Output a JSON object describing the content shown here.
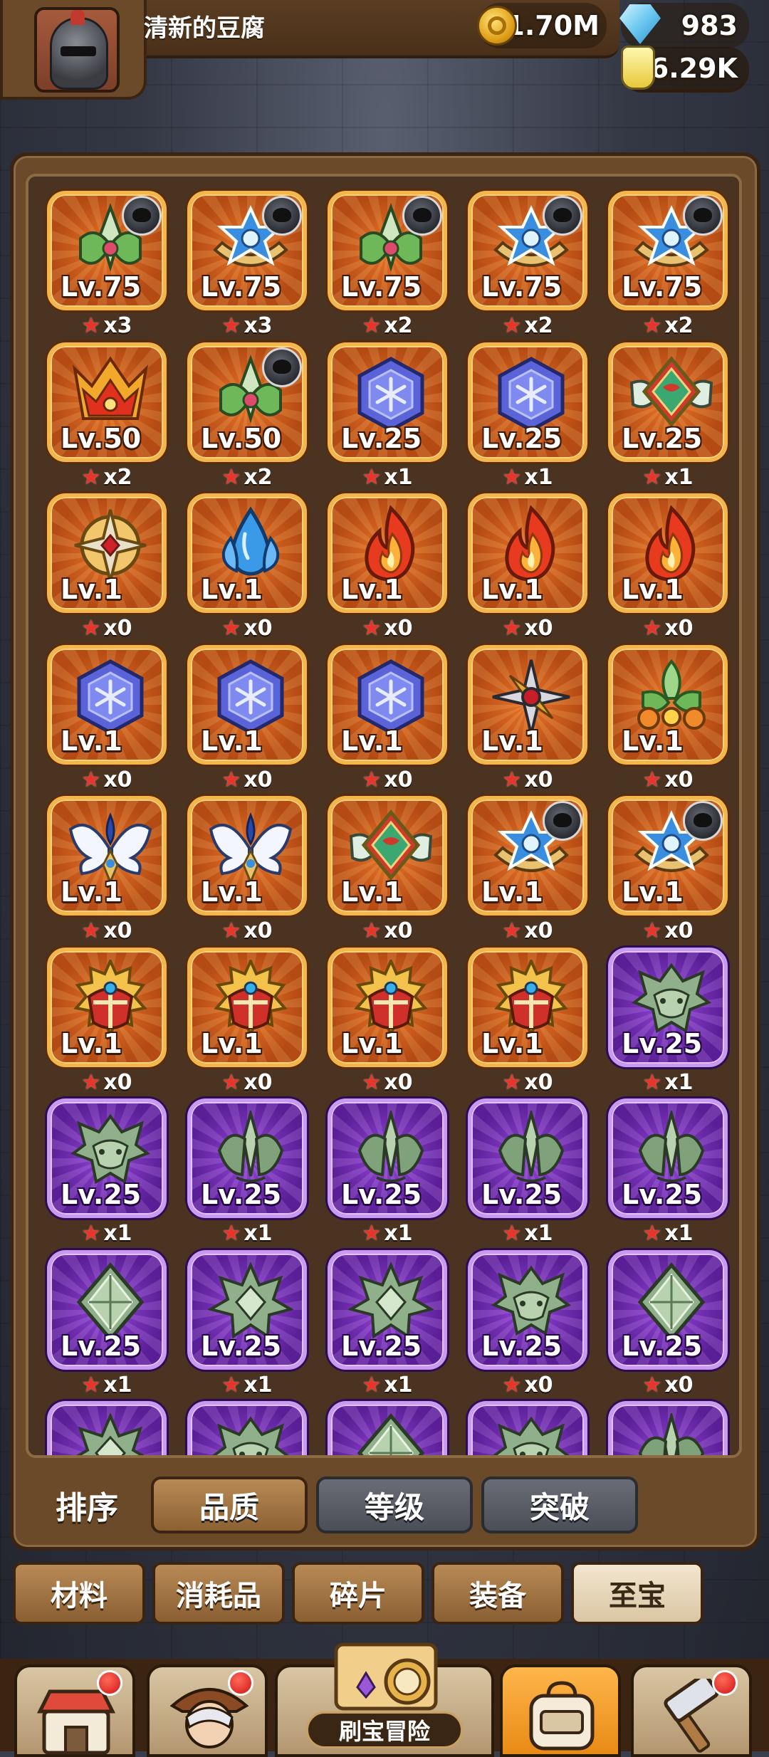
{
  "player": {
    "name": "清新的豆腐"
  },
  "currencies": {
    "gold": "1.70M",
    "diamonds": "983",
    "potion": "6.29K"
  },
  "colors": {
    "orange_rarity": "#d0621f",
    "purple_rarity": "#7a35bd",
    "star": "#e8342a"
  },
  "items": [
    {
      "level": "Lv.75",
      "stars": "x3",
      "rarity": "orange",
      "icon": "green-leaf-emblem",
      "hero": true
    },
    {
      "level": "Lv.75",
      "stars": "x3",
      "rarity": "orange",
      "icon": "blue-star-emblem",
      "hero": true
    },
    {
      "level": "Lv.75",
      "stars": "x2",
      "rarity": "orange",
      "icon": "green-leaf-emblem",
      "hero": true
    },
    {
      "level": "Lv.75",
      "stars": "x2",
      "rarity": "orange",
      "icon": "blue-star-emblem",
      "hero": true
    },
    {
      "level": "Lv.75",
      "stars": "x2",
      "rarity": "orange",
      "icon": "blue-star-emblem",
      "hero": true
    },
    {
      "level": "Lv.50",
      "stars": "x2",
      "rarity": "orange",
      "icon": "fire-crown-emblem",
      "hero": false
    },
    {
      "level": "Lv.50",
      "stars": "x2",
      "rarity": "orange",
      "icon": "green-leaf-emblem",
      "hero": true
    },
    {
      "level": "Lv.25",
      "stars": "x1",
      "rarity": "orange",
      "icon": "snowflake-gem",
      "hero": false
    },
    {
      "level": "Lv.25",
      "stars": "x1",
      "rarity": "orange",
      "icon": "snowflake-gem",
      "hero": false
    },
    {
      "level": "Lv.25",
      "stars": "x1",
      "rarity": "orange",
      "icon": "winged-diamond-emblem",
      "hero": false
    },
    {
      "level": "Lv.1",
      "stars": "x0",
      "rarity": "orange",
      "icon": "golden-cross-emblem",
      "hero": false
    },
    {
      "level": "Lv.1",
      "stars": "x0",
      "rarity": "orange",
      "icon": "water-drop-emblem",
      "hero": false
    },
    {
      "level": "Lv.1",
      "stars": "x0",
      "rarity": "orange",
      "icon": "flame-emblem",
      "hero": false
    },
    {
      "level": "Lv.1",
      "stars": "x0",
      "rarity": "orange",
      "icon": "flame-emblem",
      "hero": false
    },
    {
      "level": "Lv.1",
      "stars": "x0",
      "rarity": "orange",
      "icon": "flame-emblem",
      "hero": false
    },
    {
      "level": "Lv.1",
      "stars": "x0",
      "rarity": "orange",
      "icon": "snowflake-gem",
      "hero": false
    },
    {
      "level": "Lv.1",
      "stars": "x0",
      "rarity": "orange",
      "icon": "snowflake-gem",
      "hero": false
    },
    {
      "level": "Lv.1",
      "stars": "x0",
      "rarity": "orange",
      "icon": "snowflake-gem",
      "hero": false
    },
    {
      "level": "Lv.1",
      "stars": "x0",
      "rarity": "orange",
      "icon": "shuriken-emblem",
      "hero": false
    },
    {
      "level": "Lv.1",
      "stars": "x0",
      "rarity": "orange",
      "icon": "green-clover-emblem",
      "hero": false
    },
    {
      "level": "Lv.1",
      "stars": "x0",
      "rarity": "orange",
      "icon": "angel-wings-emblem",
      "hero": false
    },
    {
      "level": "Lv.1",
      "stars": "x0",
      "rarity": "orange",
      "icon": "angel-wings-emblem",
      "hero": false
    },
    {
      "level": "Lv.1",
      "stars": "x0",
      "rarity": "orange",
      "icon": "winged-diamond-emblem",
      "hero": false
    },
    {
      "level": "Lv.1",
      "stars": "x0",
      "rarity": "orange",
      "icon": "blue-star-emblem",
      "hero": true
    },
    {
      "level": "Lv.1",
      "stars": "x0",
      "rarity": "orange",
      "icon": "blue-star-emblem",
      "hero": true
    },
    {
      "level": "Lv.1",
      "stars": "x0",
      "rarity": "orange",
      "icon": "sun-shield-emblem",
      "hero": false
    },
    {
      "level": "Lv.1",
      "stars": "x0",
      "rarity": "orange",
      "icon": "sun-shield-emblem",
      "hero": false
    },
    {
      "level": "Lv.1",
      "stars": "x0",
      "rarity": "orange",
      "icon": "sun-shield-emblem",
      "hero": false
    },
    {
      "level": "Lv.1",
      "stars": "x0",
      "rarity": "orange",
      "icon": "sun-shield-emblem",
      "hero": false
    },
    {
      "level": "Lv.25",
      "stars": "x1",
      "rarity": "purple",
      "icon": "dragon-head-emblem",
      "hero": false
    },
    {
      "level": "Lv.25",
      "stars": "x1",
      "rarity": "purple",
      "icon": "dragon-head-emblem",
      "hero": false
    },
    {
      "level": "Lv.25",
      "stars": "x1",
      "rarity": "purple",
      "icon": "thorn-crest-emblem",
      "hero": false
    },
    {
      "level": "Lv.25",
      "stars": "x1",
      "rarity": "purple",
      "icon": "thorn-crest-emblem",
      "hero": false
    },
    {
      "level": "Lv.25",
      "stars": "x1",
      "rarity": "purple",
      "icon": "thorn-crest-emblem",
      "hero": false
    },
    {
      "level": "Lv.25",
      "stars": "x1",
      "rarity": "purple",
      "icon": "thorn-crest-emblem",
      "hero": false
    },
    {
      "level": "Lv.25",
      "stars": "x1",
      "rarity": "purple",
      "icon": "green-crystal-emblem",
      "hero": false
    },
    {
      "level": "Lv.25",
      "stars": "x1",
      "rarity": "purple",
      "icon": "spiked-star-emblem",
      "hero": false
    },
    {
      "level": "Lv.25",
      "stars": "x1",
      "rarity": "purple",
      "icon": "spiked-star-emblem",
      "hero": false
    },
    {
      "level": "Lv.25",
      "stars": "x0",
      "rarity": "purple",
      "icon": "dragon-head-emblem",
      "hero": false
    },
    {
      "level": "Lv.25",
      "stars": "x0",
      "rarity": "purple",
      "icon": "green-crystal-emblem",
      "hero": false
    },
    {
      "level": "",
      "stars": "",
      "rarity": "purple",
      "icon": "spiked-star-emblem",
      "hero": false
    },
    {
      "level": "",
      "stars": "",
      "rarity": "purple",
      "icon": "dragon-head-emblem",
      "hero": false
    },
    {
      "level": "",
      "stars": "",
      "rarity": "purple",
      "icon": "green-crystal-emblem",
      "hero": false
    },
    {
      "level": "",
      "stars": "",
      "rarity": "purple",
      "icon": "dragon-head-emblem",
      "hero": false
    },
    {
      "level": "",
      "stars": "",
      "rarity": "purple",
      "icon": "thorn-crest-emblem",
      "hero": false
    }
  ],
  "sort": {
    "label": "排序",
    "options": [
      "品质",
      "等级",
      "突破"
    ],
    "selected": "品质"
  },
  "categories": {
    "tabs": [
      "材料",
      "消耗品",
      "碎片",
      "装备",
      "至宝"
    ],
    "selected": "至宝"
  },
  "bottom_nav": {
    "items": [
      {
        "icon": "shop-icon",
        "badge": true
      },
      {
        "icon": "hero-icon",
        "badge": true
      },
      {
        "icon": "treasure-map-icon",
        "label": "刷宝冒险",
        "badge": false
      },
      {
        "icon": "backpack-icon",
        "badge": false,
        "active": true
      },
      {
        "icon": "forge-hammer-icon",
        "badge": true
      }
    ]
  }
}
